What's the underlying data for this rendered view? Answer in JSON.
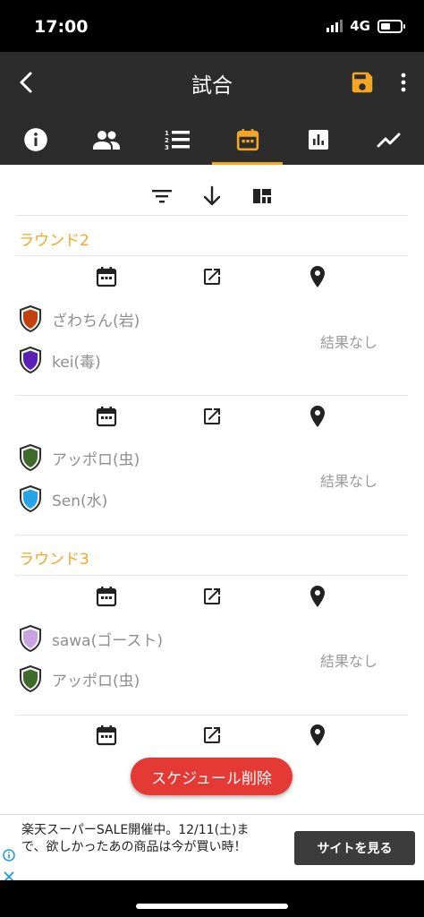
{
  "status_bar": {
    "time": "17:00",
    "network": "4G"
  },
  "app_bar": {
    "title": "試合"
  },
  "tabs": [
    {
      "icon": "info-icon",
      "active": false
    },
    {
      "icon": "people-icon",
      "active": false
    },
    {
      "icon": "ranked-list-icon",
      "active": false
    },
    {
      "icon": "calendar-icon",
      "active": true
    },
    {
      "icon": "bar-chart-icon",
      "active": false
    },
    {
      "icon": "trend-line-icon",
      "active": false
    }
  ],
  "colors": {
    "accent": "#f5a623",
    "app_bar": "#2c2c2c",
    "delete": "#e53935"
  },
  "rounds": [
    {
      "label": "ラウンド2",
      "matches": [
        {
          "players": [
            {
              "name": "ざわちん(岩)",
              "shield_color": "#c2410c"
            },
            {
              "name": "kei(毒)",
              "shield_color": "#5b21b6"
            }
          ],
          "result": "結果なし"
        },
        {
          "players": [
            {
              "name": "アッポロ(虫)",
              "shield_color": "#3f6b2a"
            },
            {
              "name": "Sen(水)",
              "shield_color": "#29a3e8"
            }
          ],
          "result": "結果なし"
        }
      ]
    },
    {
      "label": "ラウンド3",
      "matches": [
        {
          "players": [
            {
              "name": "sawa(ゴースト)",
              "shield_color": "#c9a2e0"
            },
            {
              "name": "アッポロ(虫)",
              "shield_color": "#3f6b2a"
            }
          ],
          "result": "結果なし"
        }
      ]
    }
  ],
  "delete_button": {
    "label": "スケジュール削除"
  },
  "ad": {
    "text": "楽天スーパーSALE開催中。12/11(土)まで、欲しかったあの商品は今が買い時！",
    "button": "サイトを見る"
  }
}
